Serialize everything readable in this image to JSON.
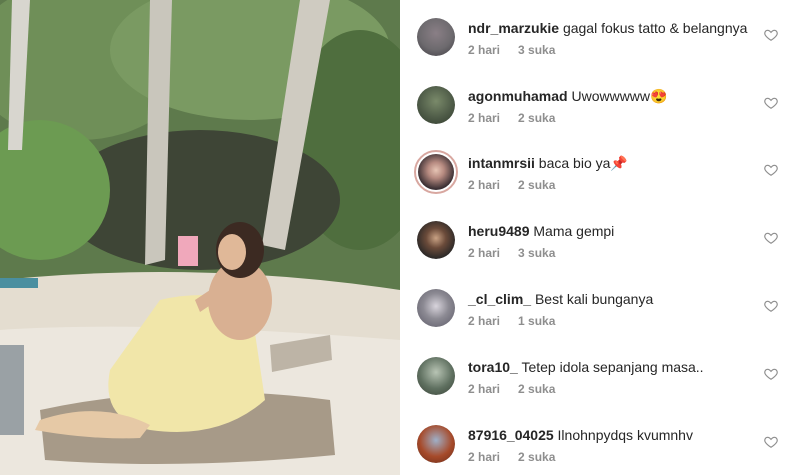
{
  "comments": [
    {
      "username": "ndr_marzukie",
      "text": "gagal fokus tatto & belangnya",
      "time": "2 hari",
      "likes": "3 suka",
      "avatar_color": "#6d6a6e"
    },
    {
      "username": "agonmuhamad",
      "text": "Uwowwwww😍",
      "time": "2 hari",
      "likes": "2 suka",
      "avatar_color": "#4f5c48"
    },
    {
      "username": "intanmrsii",
      "text": "baca bio ya📌",
      "time": "2 hari",
      "likes": "2 suka",
      "avatar_color": "#3a2f33"
    },
    {
      "username": "heru9489",
      "text": "Mama gempi",
      "time": "2 hari",
      "likes": "3 suka",
      "avatar_color": "#2e2a28"
    },
    {
      "username": "_cl_clim_",
      "text": "Best kali bunganya",
      "time": "2 hari",
      "likes": "1 suka",
      "avatar_color": "#8c8a93"
    },
    {
      "username": "tora10_",
      "text": "Tetep idola sepanjang masa..",
      "time": "2 hari",
      "likes": "2 suka",
      "avatar_color": "#5f7060"
    },
    {
      "username": "87916_04025",
      "text": "Ilnohnpydqs  kvumnhv",
      "time": "2 hari",
      "likes": "2 suka",
      "avatar_color": "#a64a2a"
    }
  ]
}
